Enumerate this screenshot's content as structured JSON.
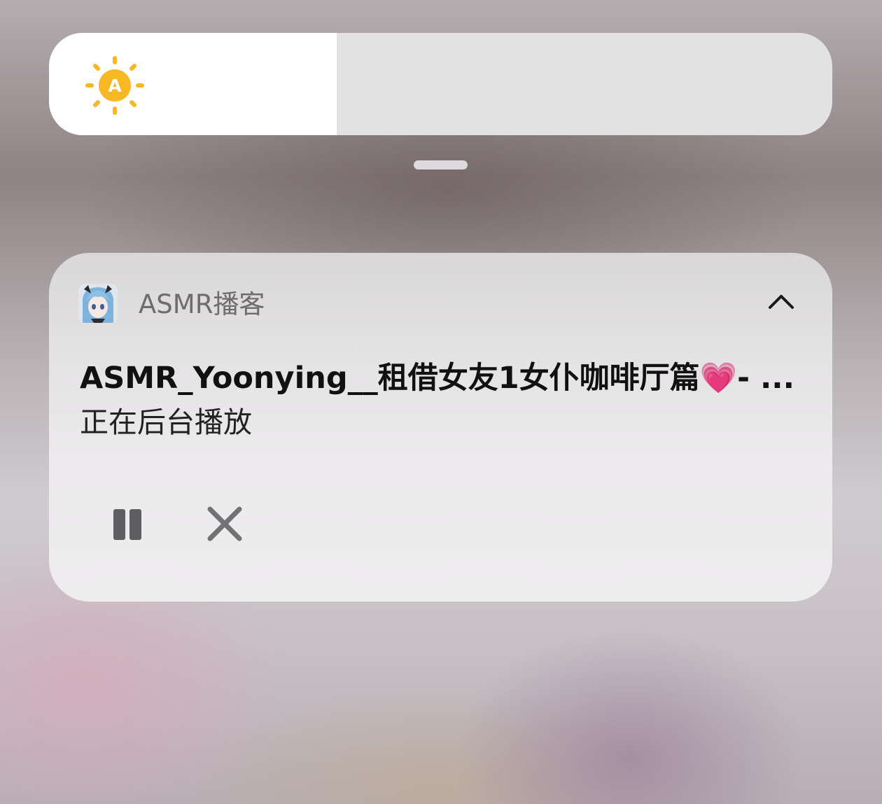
{
  "brightness": {
    "level": 0.367,
    "icon": "auto-brightness-sun-icon",
    "icon_letter": "A",
    "accent_color": "#f7b824"
  },
  "notification": {
    "app_name": "ASMR播客",
    "app_icon": "anime-avatar-app-icon",
    "title": "ASMR_Yoonying__租借女友1女仆咖啡厅篇💗- ...",
    "subtitle": "正在后台播放",
    "actions": {
      "pause_icon": "pause-icon",
      "close_icon": "close-icon"
    }
  }
}
